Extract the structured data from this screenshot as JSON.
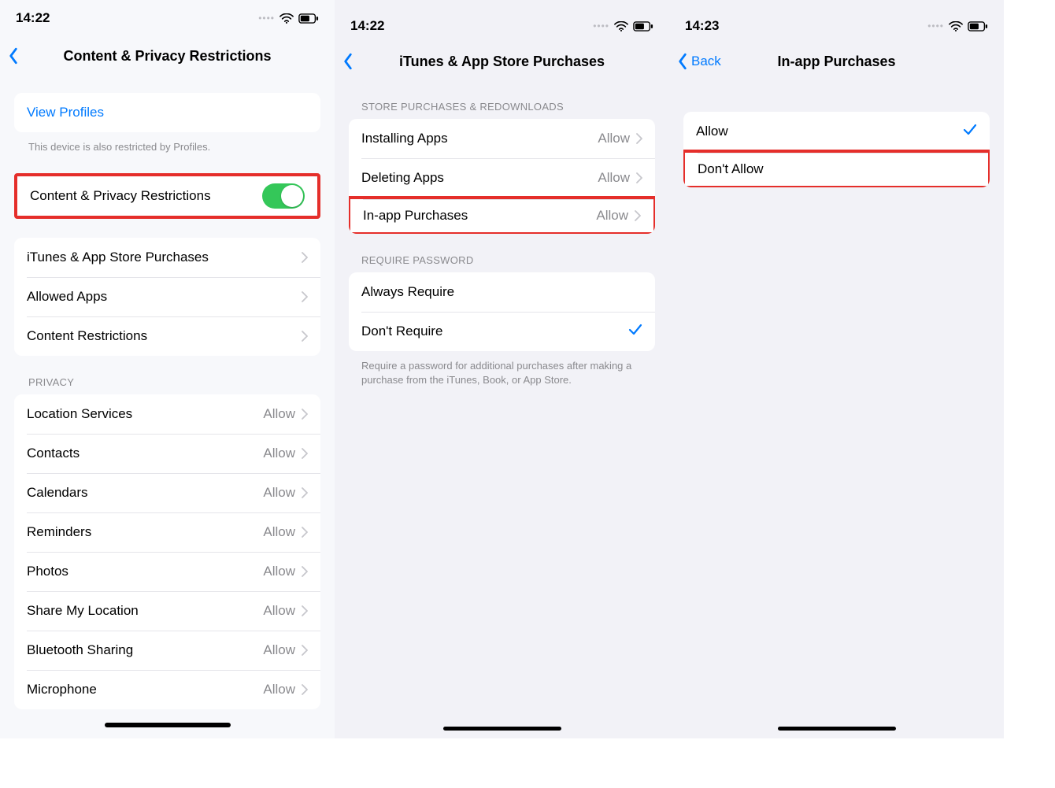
{
  "screens": {
    "s1": {
      "time": "14:22",
      "title": "Content & Privacy Restrictions",
      "view_profiles": "View Profiles",
      "profiles_note": "This device is also restricted by Profiles.",
      "toggle_label": "Content & Privacy Restrictions",
      "menu": [
        {
          "label": "iTunes & App Store Purchases"
        },
        {
          "label": "Allowed Apps"
        },
        {
          "label": "Content Restrictions"
        }
      ],
      "privacy_header": "PRIVACY",
      "privacy": [
        {
          "label": "Location Services",
          "value": "Allow"
        },
        {
          "label": "Contacts",
          "value": "Allow"
        },
        {
          "label": "Calendars",
          "value": "Allow"
        },
        {
          "label": "Reminders",
          "value": "Allow"
        },
        {
          "label": "Photos",
          "value": "Allow"
        },
        {
          "label": "Share My Location",
          "value": "Allow"
        },
        {
          "label": "Bluetooth Sharing",
          "value": "Allow"
        },
        {
          "label": "Microphone",
          "value": "Allow"
        }
      ]
    },
    "s2": {
      "time": "14:22",
      "title": "iTunes & App Store Purchases",
      "store_header": "STORE PURCHASES & REDOWNLOADS",
      "store": [
        {
          "label": "Installing Apps",
          "value": "Allow"
        },
        {
          "label": "Deleting Apps",
          "value": "Allow"
        },
        {
          "label": "In-app Purchases",
          "value": "Allow"
        }
      ],
      "pwd_header": "REQUIRE PASSWORD",
      "pwd": [
        {
          "label": "Always Require",
          "checked": false
        },
        {
          "label": "Don't Require",
          "checked": true
        }
      ],
      "pwd_note": "Require a password for additional purchases after making a purchase from the iTunes, Book, or App Store."
    },
    "s3": {
      "time": "14:23",
      "back": "Back",
      "title": "In-app Purchases",
      "options": [
        {
          "label": "Allow",
          "checked": true
        },
        {
          "label": "Don't Allow",
          "checked": false
        }
      ]
    }
  }
}
